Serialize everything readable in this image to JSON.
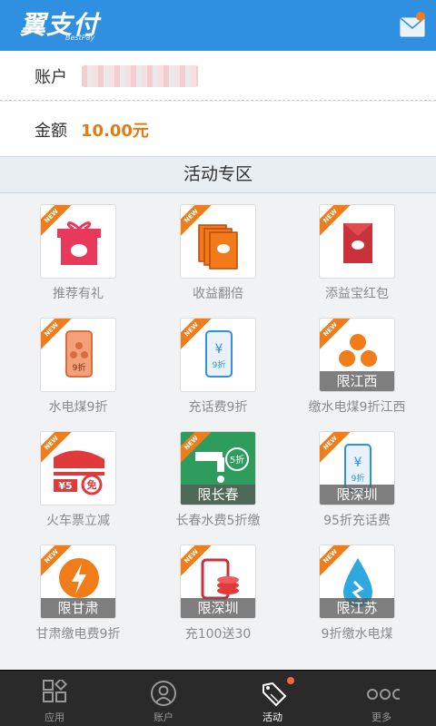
{
  "header": {
    "app_name": "翼支付",
    "app_sub": "BestPay",
    "mail_icon": "mail-icon"
  },
  "account": {
    "label": "账户",
    "value_masked": true
  },
  "amount": {
    "label": "金额",
    "value": "10.00元",
    "color": "#e47b12"
  },
  "section": {
    "title": "活动专区"
  },
  "badge_text": "NEW",
  "tiles": [
    {
      "label": "推荐有礼",
      "icon": "gift-box-icon",
      "region": ""
    },
    {
      "label": "收益翻倍",
      "icon": "red-envelopes-icon",
      "region": ""
    },
    {
      "label": "添益宝红包",
      "icon": "red-envelope-icon",
      "region": ""
    },
    {
      "label": "水电煤9折",
      "icon": "phone-utility-icon",
      "region": ""
    },
    {
      "label": "充话费9折",
      "icon": "phone-yuan-icon",
      "region": ""
    },
    {
      "label": "缴水电煤9折江西",
      "icon": "utility-drops-icon",
      "region": "限江西"
    },
    {
      "label": "火车票立减",
      "icon": "train-icon",
      "region": ""
    },
    {
      "label": "长春水费5折缴",
      "icon": "water-tap-icon",
      "region": "限长春"
    },
    {
      "label": "95折充话费",
      "icon": "phone-yuan-icon",
      "region": "限深圳"
    },
    {
      "label": "甘肃缴电费9折",
      "icon": "lightning-icon",
      "region": "限甘肃"
    },
    {
      "label": "充100送30",
      "icon": "phone-coins-icon",
      "region": "限深圳"
    },
    {
      "label": "9折缴水电煤",
      "icon": "water-drop-icon",
      "region": "限江苏"
    }
  ],
  "tabbar": [
    {
      "label": "应用",
      "icon": "apps-grid-icon",
      "active": false
    },
    {
      "label": "账户",
      "icon": "user-icon",
      "active": false
    },
    {
      "label": "活动",
      "icon": "tag-icon",
      "active": true
    },
    {
      "label": "更多",
      "icon": "more-dots-icon",
      "active": false
    }
  ]
}
